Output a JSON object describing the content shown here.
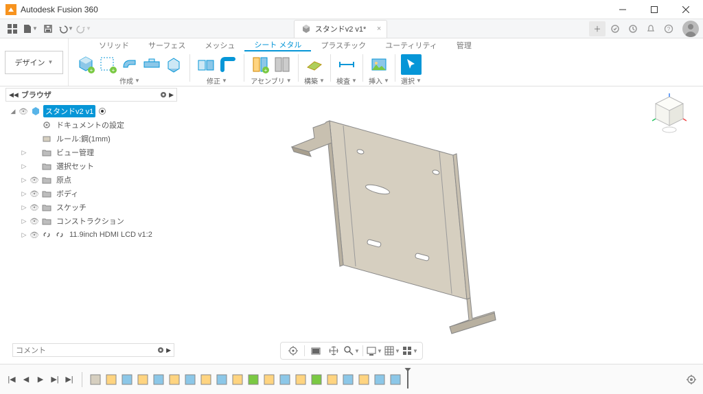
{
  "app": {
    "title": "Autodesk Fusion 360"
  },
  "tab": {
    "title": "スタンドv2 v1*"
  },
  "ribbon": {
    "design_label": "デザイン",
    "tabs": [
      "ソリッド",
      "サーフェス",
      "メッシュ",
      "シート メタル",
      "プラスチック",
      "ユーティリティ",
      "管理"
    ],
    "active_tab_index": 3,
    "groups": {
      "create": "作成",
      "modify": "修正",
      "assemble": "アセンブリ",
      "construct": "構築",
      "inspect": "検査",
      "insert": "挿入",
      "select": "選択"
    }
  },
  "browser": {
    "title": "ブラウザ",
    "root": "スタンドv2 v1",
    "items": [
      {
        "label": "ドキュメントの設定",
        "icon": "gear"
      },
      {
        "label": "ルール:鋼(1mm)",
        "icon": "rule"
      },
      {
        "label": "ビュー管理",
        "icon": "folder",
        "arrow": true
      },
      {
        "label": "選択セット",
        "icon": "folder",
        "arrow": true
      },
      {
        "label": "原点",
        "icon": "folder",
        "eye": true,
        "arrow": true
      },
      {
        "label": "ボディ",
        "icon": "folder",
        "eye": true,
        "arrow": true
      },
      {
        "label": "スケッチ",
        "icon": "folder",
        "eye": true,
        "arrow": true
      },
      {
        "label": "コンストラクション",
        "icon": "folder",
        "eye": true,
        "arrow": true
      },
      {
        "label": "11.9inch HDMI LCD v1:2",
        "icon": "link",
        "eye": true,
        "arrow": true
      }
    ]
  },
  "comment": {
    "label": "コメント"
  }
}
